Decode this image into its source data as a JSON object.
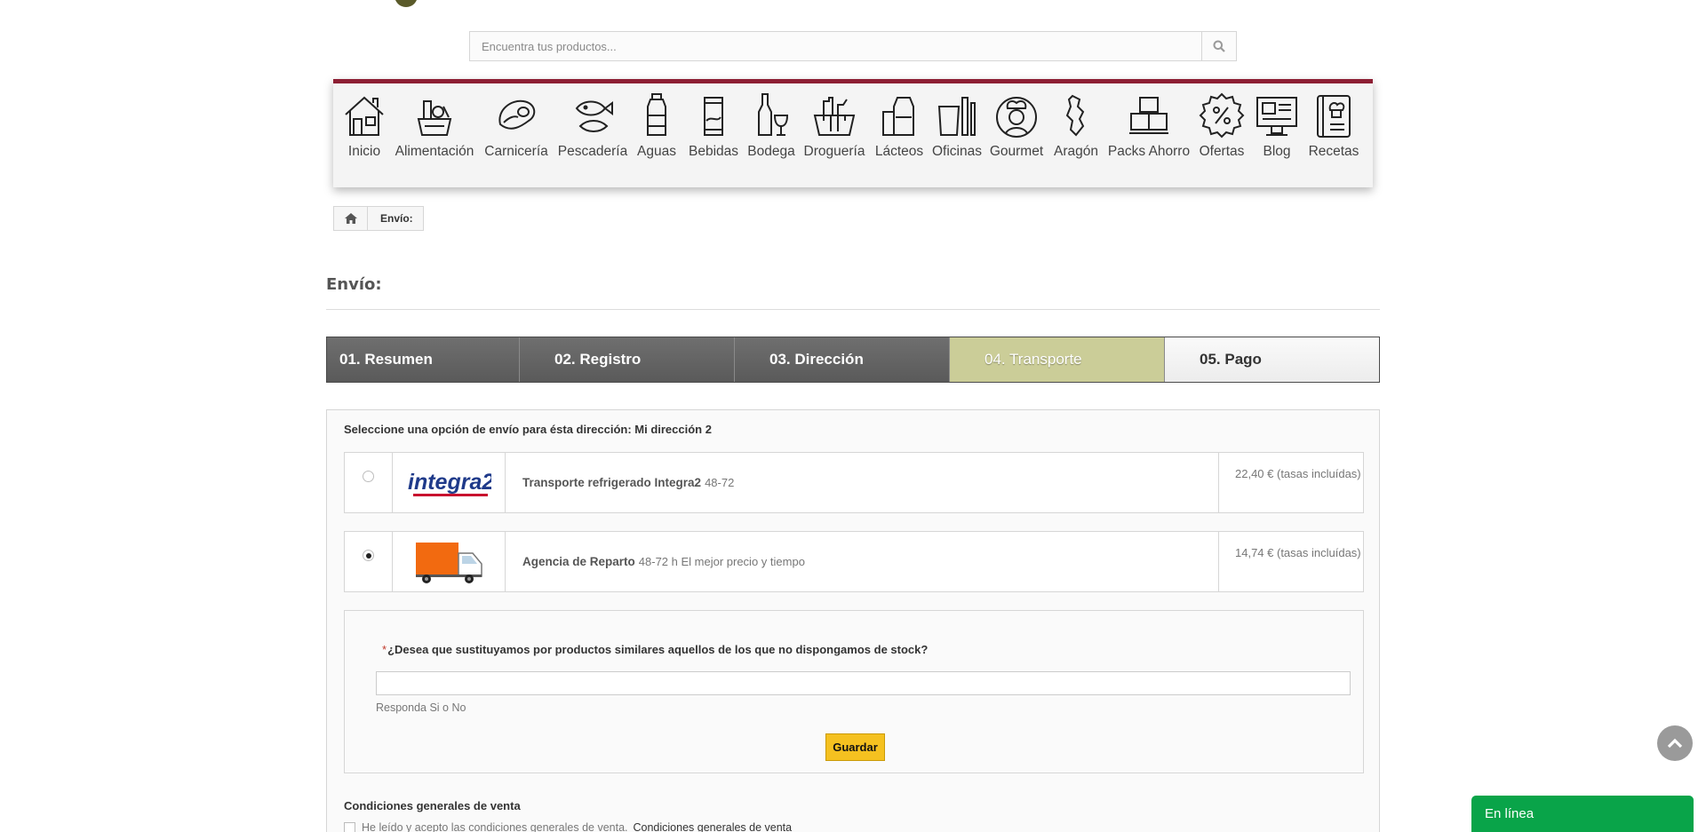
{
  "search": {
    "placeholder": "Encuentra tus productos..."
  },
  "nav": {
    "items": [
      {
        "label": "Inicio",
        "icon": "house-icon"
      },
      {
        "label": "Alimentación",
        "icon": "grocery-icon"
      },
      {
        "label": "Carnicería",
        "icon": "steak-icon"
      },
      {
        "label": "Pescadería",
        "icon": "fish-icon"
      },
      {
        "label": "Aguas",
        "icon": "water-bottle-icon"
      },
      {
        "label": "Bebidas",
        "icon": "can-icon"
      },
      {
        "label": "Bodega",
        "icon": "wine-icon"
      },
      {
        "label": "Droguería",
        "icon": "cleaning-basket-icon"
      },
      {
        "label": "Lácteos",
        "icon": "milk-icon"
      },
      {
        "label": "Oficinas",
        "icon": "office-supplies-icon"
      },
      {
        "label": "Gourmet",
        "icon": "chef-icon"
      },
      {
        "label": "Aragón",
        "icon": "region-map-icon"
      },
      {
        "label": "Packs Ahorro",
        "icon": "boxes-icon"
      },
      {
        "label": "Ofertas",
        "icon": "percent-badge-icon"
      },
      {
        "label": "Blog",
        "icon": "monitor-icon"
      },
      {
        "label": "Recetas",
        "icon": "recipe-book-icon"
      }
    ]
  },
  "breadcrumb": {
    "current": "Envío:"
  },
  "page": {
    "title": "Envío:"
  },
  "steps": [
    {
      "label": "01. Resumen",
      "state": "done"
    },
    {
      "label": "02. Registro",
      "state": "done"
    },
    {
      "label": "03. Dirección",
      "state": "done"
    },
    {
      "label": "04. Transporte",
      "state": "current"
    },
    {
      "label": "05. Pago",
      "state": "todo"
    }
  ],
  "shipping": {
    "heading": "Seleccione una opción de envío para ésta dirección: Mi dirección 2",
    "carriers": [
      {
        "logo_text": "integra2",
        "name": "Transporte refrigerado Integra2",
        "delay": "48-72",
        "price": "22,40 € (tasas incluídas)",
        "selected": false
      },
      {
        "logo_text": "",
        "name": "Agencia de Reparto",
        "delay": "48-72 h El mejor precio y tiempo",
        "price": "14,74 € (tasas incluídas)",
        "selected": true
      }
    ]
  },
  "stock_question": {
    "label": "¿Desea que sustituyamos por productos similares aquellos de los que no dispongamos de stock?",
    "value": "",
    "help": "Responda Si o No",
    "save_label": "Guardar"
  },
  "terms": {
    "title": "Condiciones generales de venta",
    "checkbox_label": "He leído y acepto las condiciones generales de venta.",
    "link_label": "Condiciones generales de venta"
  },
  "chat": {
    "label": "En línea"
  },
  "colors": {
    "nav_accent": "#8d1f34",
    "step_current": "#cbcd98",
    "button": "#f5c120",
    "chat": "#09a449"
  }
}
